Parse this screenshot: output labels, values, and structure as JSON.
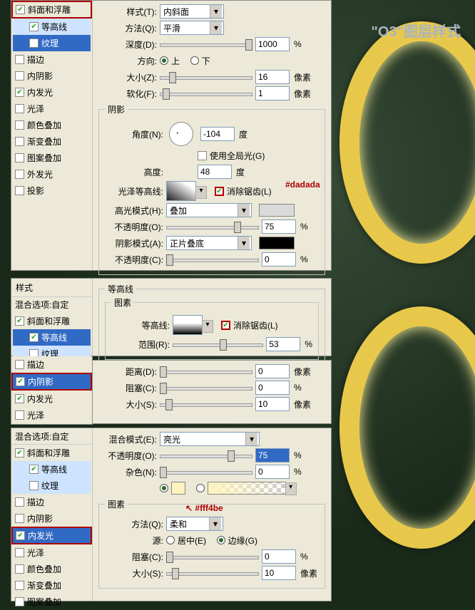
{
  "title_overlay": "\"O3\"图层样式",
  "anno_dadada": "#dadada",
  "anno_fff4be": "#fff4be",
  "sidebar": {
    "header_styles": "样式",
    "blend_options": "混合选项:自定",
    "items_main": [
      {
        "label": "斜面和浮雕",
        "on": true,
        "sel": false
      },
      {
        "label": "等高线",
        "on": true,
        "sel": false,
        "sub": true
      },
      {
        "label": "纹理",
        "on": false,
        "sel": true,
        "sub": true
      },
      {
        "label": "描边",
        "on": false
      },
      {
        "label": "内阴影",
        "on": false
      },
      {
        "label": "内发光",
        "on": true
      },
      {
        "label": "光泽",
        "on": false
      },
      {
        "label": "颜色叠加",
        "on": false
      },
      {
        "label": "渐变叠加",
        "on": false
      },
      {
        "label": "图案叠加",
        "on": false
      },
      {
        "label": "外发光",
        "on": false
      },
      {
        "label": "投影",
        "on": false
      }
    ],
    "items2": [
      {
        "label": "斜面和浮雕",
        "on": true
      },
      {
        "label": "等高线",
        "on": true,
        "sel": true,
        "sub": true
      },
      {
        "label": "纹理",
        "on": false,
        "sub": true
      },
      {
        "label": "描边",
        "on": false
      },
      {
        "label": "内阴影",
        "on": true,
        "sel": true,
        "red": true
      },
      {
        "label": "内发光",
        "on": true
      },
      {
        "label": "光泽",
        "on": false
      }
    ],
    "items3": [
      {
        "label": "斜面和浮雕",
        "on": true
      },
      {
        "label": "等高线",
        "on": true,
        "sub": true
      },
      {
        "label": "纹理",
        "on": false,
        "sub": true
      },
      {
        "label": "描边",
        "on": false
      },
      {
        "label": "内阴影",
        "on": false
      },
      {
        "label": "内发光",
        "on": true,
        "sel": true,
        "red": true
      },
      {
        "label": "光泽",
        "on": false
      },
      {
        "label": "颜色叠加",
        "on": false
      },
      {
        "label": "渐变叠加",
        "on": false
      },
      {
        "label": "图案叠加",
        "on": false
      }
    ]
  },
  "panel1": {
    "style_lbl": "样式(T):",
    "style_val": "内斜面",
    "method_lbl": "方法(Q):",
    "method_val": "平滑",
    "depth_lbl": "深度(D):",
    "depth_val": "1000",
    "depth_unit": "%",
    "direction_lbl": "方向:",
    "dir_up": "上",
    "dir_down": "下",
    "size_lbl": "大小(Z):",
    "size_val": "16",
    "size_unit": "像素",
    "soften_lbl": "软化(F):",
    "soften_val": "1",
    "soften_unit": "像素",
    "shadow_legend": "阴影",
    "angle_lbl": "角度(N):",
    "angle_val": "-104",
    "angle_unit": "度",
    "global_lbl": "使用全局光(G)",
    "altitude_lbl": "高度:",
    "altitude_val": "48",
    "altitude_unit": "度",
    "gloss_lbl": "光泽等高线:",
    "antialias_lbl": "消除锯齿(L)",
    "hmode_lbl": "高光模式(H):",
    "hmode_val": "叠加",
    "hopacity_lbl": "不透明度(O):",
    "hopacity_val": "75",
    "pct": "%",
    "smode_lbl": "阴影模式(A):",
    "smode_val": "正片叠底",
    "sopacity_lbl": "不透明度(C):",
    "sopacity_val": "0"
  },
  "panel2": {
    "legend": "等高线",
    "sub_legend": "图素",
    "contour_lbl": "等高线:",
    "antialias_lbl": "消除锯齿(L)",
    "range_lbl": "范围(R):",
    "range_val": "53",
    "pct": "%"
  },
  "panel3": {
    "distance_lbl": "距离(D):",
    "distance_val": "0",
    "px": "像素",
    "choke_lbl": "阻塞(C):",
    "choke_val": "0",
    "pct": "%",
    "size_lbl": "大小(S):",
    "size_val": "10"
  },
  "panel4": {
    "blend_lbl": "混合模式(E):",
    "blend_val": "亮光",
    "opacity_lbl": "不透明度(O):",
    "opacity_val": "75",
    "pct": "%",
    "noise_lbl": "杂色(N):",
    "noise_val": "0",
    "legend": "图素",
    "method_lbl": "方法(Q):",
    "method_val": "柔和",
    "source_lbl": "源:",
    "source_center": "居中(E)",
    "source_edge": "边缘(G)",
    "choke_lbl": "阻塞(C):",
    "choke_val": "0",
    "size_lbl": "大小(S):",
    "size_val": "10",
    "px": "像素"
  }
}
